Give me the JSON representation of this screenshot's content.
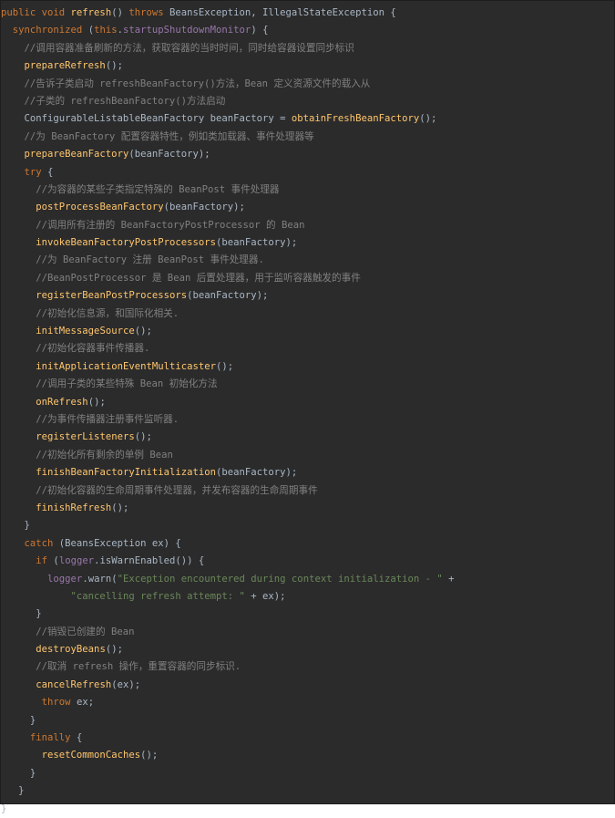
{
  "editor": {
    "lines": [
      [
        {
          "t": "public void ",
          "k": "kw"
        },
        {
          "t": "refresh",
          "k": "fn"
        },
        {
          "t": "() ",
          "k": "plain"
        },
        {
          "t": "throws ",
          "k": "kw"
        },
        {
          "t": "BeansException, IllegalStateException {",
          "k": "plain"
        }
      ],
      [
        {
          "t": "  ",
          "k": "plain"
        },
        {
          "t": "synchronized ",
          "k": "kw"
        },
        {
          "t": "(",
          "k": "plain"
        },
        {
          "t": "this",
          "k": "kw"
        },
        {
          "t": ".",
          "k": "plain"
        },
        {
          "t": "startupShutdownMonitor",
          "k": "field"
        },
        {
          "t": ") {",
          "k": "plain"
        }
      ],
      [
        {
          "t": "    ",
          "k": "plain"
        },
        {
          "t": "//调用容器准备刷新的方法，获取容器的当时时间，同时给容器设置同步标识",
          "k": "cm"
        }
      ],
      [
        {
          "t": "    ",
          "k": "plain"
        },
        {
          "t": "prepareRefresh",
          "k": "fn"
        },
        {
          "t": "();",
          "k": "plain"
        }
      ],
      [
        {
          "t": "    ",
          "k": "plain"
        },
        {
          "t": "//告诉子类启动 refreshBeanFactory()方法，Bean 定义资源文件的载入从",
          "k": "cm"
        }
      ],
      [
        {
          "t": "    ",
          "k": "plain"
        },
        {
          "t": "//子类的 refreshBeanFactory()方法启动",
          "k": "cm"
        }
      ],
      [
        {
          "t": "    ConfigurableListableBeanFactory beanFactory = ",
          "k": "plain"
        },
        {
          "t": "obtainFreshBeanFactory",
          "k": "fn"
        },
        {
          "t": "();",
          "k": "plain"
        }
      ],
      [
        {
          "t": "    ",
          "k": "plain"
        },
        {
          "t": "//为 BeanFactory 配置容器特性，例如类加载器、事件处理器等",
          "k": "cm"
        }
      ],
      [
        {
          "t": "    ",
          "k": "plain"
        },
        {
          "t": "prepareBeanFactory",
          "k": "fn"
        },
        {
          "t": "(beanFactory);",
          "k": "plain"
        }
      ],
      [
        {
          "t": "    ",
          "k": "plain"
        },
        {
          "t": "try ",
          "k": "kw"
        },
        {
          "t": "{",
          "k": "plain"
        }
      ],
      [
        {
          "t": "      ",
          "k": "plain"
        },
        {
          "t": "//为容器的某些子类指定特殊的 BeanPost 事件处理器",
          "k": "cm"
        }
      ],
      [
        {
          "t": "      ",
          "k": "plain"
        },
        {
          "t": "postProcessBeanFactory",
          "k": "fn"
        },
        {
          "t": "(beanFactory);",
          "k": "plain"
        }
      ],
      [
        {
          "t": "      ",
          "k": "plain"
        },
        {
          "t": "//调用所有注册的 BeanFactoryPostProcessor 的 Bean",
          "k": "cm"
        }
      ],
      [
        {
          "t": "      ",
          "k": "plain"
        },
        {
          "t": "invokeBeanFactoryPostProcessors",
          "k": "fn"
        },
        {
          "t": "(beanFactory);",
          "k": "plain"
        }
      ],
      [
        {
          "t": "      ",
          "k": "plain"
        },
        {
          "t": "//为 BeanFactory 注册 BeanPost 事件处理器.",
          "k": "cm"
        }
      ],
      [
        {
          "t": "      ",
          "k": "plain"
        },
        {
          "t": "//BeanPostProcessor 是 Bean 后置处理器，用于监听容器触发的事件",
          "k": "cm"
        }
      ],
      [
        {
          "t": "      ",
          "k": "plain"
        },
        {
          "t": "registerBeanPostProcessors",
          "k": "fn"
        },
        {
          "t": "(beanFactory);",
          "k": "plain"
        }
      ],
      [
        {
          "t": "      ",
          "k": "plain"
        },
        {
          "t": "//初始化信息源，和国际化相关.",
          "k": "cm"
        }
      ],
      [
        {
          "t": "      ",
          "k": "plain"
        },
        {
          "t": "initMessageSource",
          "k": "fn"
        },
        {
          "t": "();",
          "k": "plain"
        }
      ],
      [
        {
          "t": "      ",
          "k": "plain"
        },
        {
          "t": "//初始化容器事件传播器.",
          "k": "cm"
        }
      ],
      [
        {
          "t": "      ",
          "k": "plain"
        },
        {
          "t": "initApplicationEventMulticaster",
          "k": "fn"
        },
        {
          "t": "();",
          "k": "plain"
        }
      ],
      [
        {
          "t": "      ",
          "k": "plain"
        },
        {
          "t": "//调用子类的某些特殊 Bean 初始化方法",
          "k": "cm"
        }
      ],
      [
        {
          "t": "      ",
          "k": "plain"
        },
        {
          "t": "onRefresh",
          "k": "fn"
        },
        {
          "t": "();",
          "k": "plain"
        }
      ],
      [
        {
          "t": "      ",
          "k": "plain"
        },
        {
          "t": "//为事件传播器注册事件监听器.",
          "k": "cm"
        }
      ],
      [
        {
          "t": "      ",
          "k": "plain"
        },
        {
          "t": "registerListeners",
          "k": "fn"
        },
        {
          "t": "();",
          "k": "plain"
        }
      ],
      [
        {
          "t": "      ",
          "k": "plain"
        },
        {
          "t": "//初始化所有剩余的单例 Bean",
          "k": "cm"
        }
      ],
      [
        {
          "t": "      ",
          "k": "plain"
        },
        {
          "t": "finishBeanFactoryInitialization",
          "k": "fn"
        },
        {
          "t": "(beanFactory);",
          "k": "plain"
        }
      ],
      [
        {
          "t": "      ",
          "k": "plain"
        },
        {
          "t": "//初始化容器的生命周期事件处理器，并发布容器的生命周期事件",
          "k": "cm"
        }
      ],
      [
        {
          "t": "      ",
          "k": "plain"
        },
        {
          "t": "finishRefresh",
          "k": "fn"
        },
        {
          "t": "();",
          "k": "plain"
        }
      ],
      [
        {
          "t": "    }",
          "k": "plain"
        }
      ],
      [
        {
          "t": "    ",
          "k": "plain"
        },
        {
          "t": "catch ",
          "k": "kw"
        },
        {
          "t": "(BeansException ex) {",
          "k": "plain"
        }
      ],
      [
        {
          "t": "      ",
          "k": "plain"
        },
        {
          "t": "if ",
          "k": "kw"
        },
        {
          "t": "(",
          "k": "plain"
        },
        {
          "t": "logger",
          "k": "field"
        },
        {
          "t": ".isWarnEnabled()) {",
          "k": "plain"
        }
      ],
      [
        {
          "t": "        ",
          "k": "plain"
        },
        {
          "t": "logger",
          "k": "field"
        },
        {
          "t": ".warn(",
          "k": "plain"
        },
        {
          "t": "\"Exception encountered during context initialization - \"",
          "k": "str"
        },
        {
          "t": " +",
          "k": "plain"
        }
      ],
      [
        {
          "t": "            ",
          "k": "plain"
        },
        {
          "t": "\"cancelling refresh attempt: \"",
          "k": "str"
        },
        {
          "t": " + ex);",
          "k": "plain"
        }
      ],
      [
        {
          "t": "      }",
          "k": "plain"
        }
      ],
      [
        {
          "t": "      ",
          "k": "plain"
        },
        {
          "t": "//销毁已创建的 Bean",
          "k": "cm"
        }
      ],
      [
        {
          "t": "      ",
          "k": "plain"
        },
        {
          "t": "destroyBeans",
          "k": "fn"
        },
        {
          "t": "();",
          "k": "plain"
        }
      ],
      [
        {
          "t": "      ",
          "k": "plain"
        },
        {
          "t": "//取消 refresh 操作，重置容器的同步标识.",
          "k": "cm"
        }
      ],
      [
        {
          "t": "      ",
          "k": "plain"
        },
        {
          "t": "cancelRefresh",
          "k": "fn"
        },
        {
          "t": "(ex);",
          "k": "plain"
        }
      ],
      [
        {
          "t": "       ",
          "k": "plain"
        },
        {
          "t": "throw ",
          "k": "kw"
        },
        {
          "t": "ex;",
          "k": "plain"
        }
      ],
      [
        {
          "t": "     }",
          "k": "plain"
        }
      ],
      [
        {
          "t": "     ",
          "k": "plain"
        },
        {
          "t": "finally ",
          "k": "kw"
        },
        {
          "t": "{",
          "k": "plain"
        }
      ],
      [
        {
          "t": "       ",
          "k": "plain"
        },
        {
          "t": "resetCommonCaches",
          "k": "fn"
        },
        {
          "t": "();",
          "k": "plain"
        }
      ],
      [
        {
          "t": "     }",
          "k": "plain"
        }
      ],
      [
        {
          "t": "   }",
          "k": "plain"
        }
      ],
      [
        {
          "t": "}",
          "k": "plain"
        }
      ]
    ],
    "colors": {
      "background": "#2b2b2b",
      "keyword": "#cc7832",
      "method": "#ffc66d",
      "field": "#9876aa",
      "string": "#6a8759",
      "comment": "#808080",
      "text": "#a9b7c6"
    }
  }
}
